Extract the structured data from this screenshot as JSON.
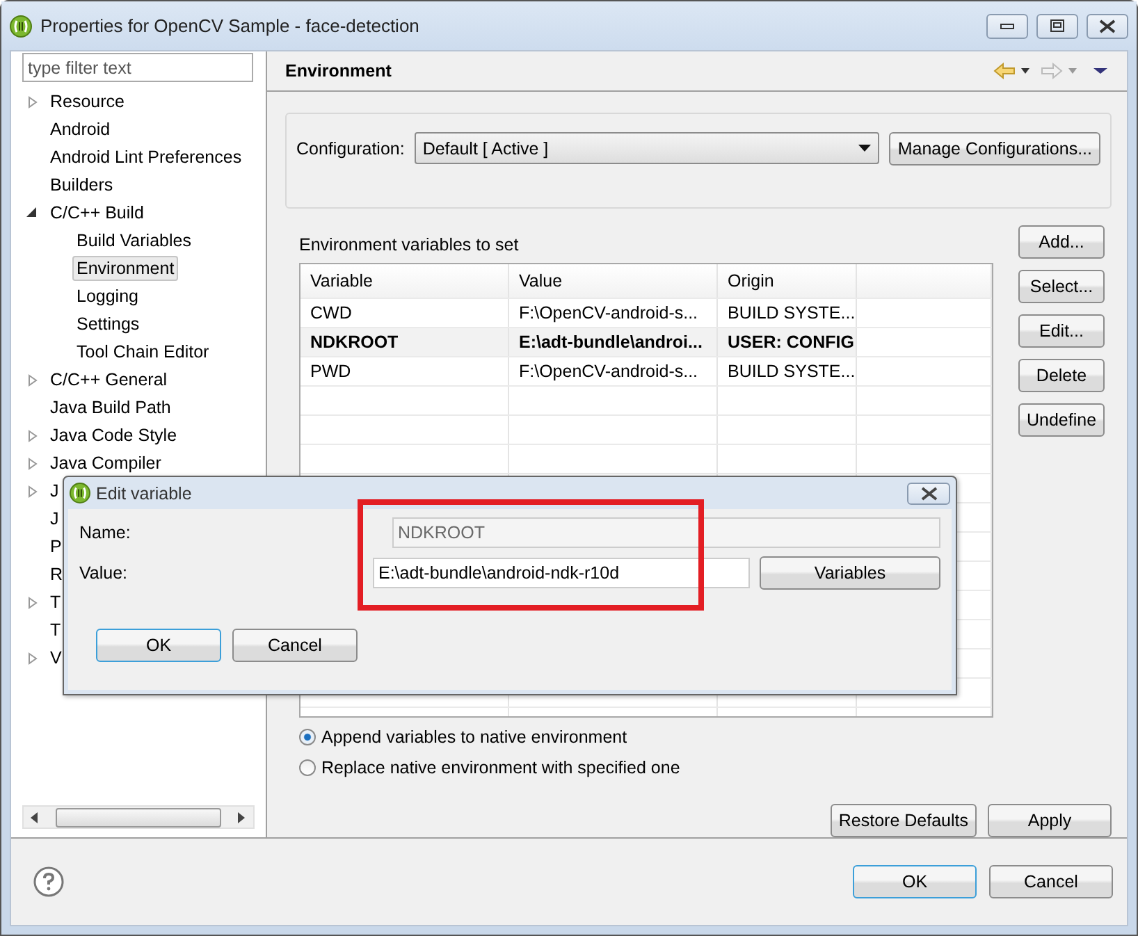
{
  "window": {
    "title": "Properties for OpenCV Sample - face-detection"
  },
  "sidebar": {
    "filter": {
      "placeholder": "type filter text"
    },
    "items": [
      {
        "label": "Resource",
        "expandable": true,
        "expanded": false,
        "selected": false
      },
      {
        "label": "Android",
        "expandable": false,
        "selected": false
      },
      {
        "label": "Android Lint Preferences",
        "expandable": false,
        "selected": false
      },
      {
        "label": "Builders",
        "expandable": false,
        "selected": false
      },
      {
        "label": "C/C++ Build",
        "expandable": true,
        "expanded": true,
        "selected": false,
        "children": [
          {
            "label": "Build Variables",
            "expandable": false,
            "selected": false
          },
          {
            "label": "Environment",
            "expandable": false,
            "selected": true
          },
          {
            "label": "Logging",
            "expandable": false,
            "selected": false
          },
          {
            "label": "Settings",
            "expandable": false,
            "selected": false
          },
          {
            "label": "Tool Chain Editor",
            "expandable": false,
            "selected": false
          }
        ]
      },
      {
        "label": "C/C++ General",
        "expandable": true,
        "expanded": false,
        "selected": false
      },
      {
        "label": "Java Build Path",
        "expandable": false,
        "selected": false
      },
      {
        "label": "Java Code Style",
        "expandable": true,
        "expanded": false,
        "selected": false
      },
      {
        "label": "Java Compiler",
        "expandable": true,
        "expanded": false,
        "selected": false
      },
      {
        "label": "J",
        "expandable": true,
        "expanded": false,
        "selected": false
      },
      {
        "label": "J",
        "expandable": false,
        "selected": false
      },
      {
        "label": "P",
        "expandable": false,
        "selected": false
      },
      {
        "label": "R",
        "expandable": false,
        "selected": false
      },
      {
        "label": "T",
        "expandable": true,
        "expanded": false,
        "selected": false
      },
      {
        "label": "T",
        "expandable": false,
        "selected": false
      },
      {
        "label": "V",
        "expandable": true,
        "expanded": false,
        "selected": false
      }
    ]
  },
  "page": {
    "title": "Environment",
    "configuration": {
      "label": "Configuration:",
      "value": "Default  [ Active ]",
      "button": "Manage Configurations..."
    },
    "table": {
      "label": "Environment variables to set",
      "columns": [
        "Variable",
        "Value",
        "Origin"
      ],
      "rows": [
        {
          "cells": [
            "CWD",
            "F:\\OpenCV-android-s...",
            "BUILD SYSTE..."
          ],
          "selected": false
        },
        {
          "cells": [
            "NDKROOT",
            "E:\\adt-bundle\\androi...",
            "USER: CONFIG"
          ],
          "selected": true
        },
        {
          "cells": [
            "PWD",
            "F:\\OpenCV-android-s...",
            "BUILD SYSTE..."
          ],
          "selected": false
        }
      ]
    },
    "side_buttons": [
      "Add...",
      "Select...",
      "Edit...",
      "Delete",
      "Undefine"
    ],
    "radios": [
      {
        "label": "Append variables to native environment",
        "selected": true
      },
      {
        "label": "Replace native environment with specified one",
        "selected": false
      }
    ],
    "page_buttons": [
      "Restore Defaults",
      "Apply"
    ]
  },
  "footer": {
    "buttons": [
      {
        "label": "OK",
        "default": true
      },
      {
        "label": "Cancel",
        "default": false
      }
    ]
  },
  "dialog": {
    "title": "Edit variable",
    "fields": [
      {
        "label": "Name:",
        "value": "NDKROOT",
        "disabled": true
      },
      {
        "label": "Value:",
        "value": "E:\\adt-bundle\\android-ndk-r10d",
        "disabled": false
      }
    ],
    "variables_button": "Variables",
    "buttons": [
      {
        "label": "OK",
        "default": true
      },
      {
        "label": "Cancel",
        "default": false
      }
    ]
  }
}
